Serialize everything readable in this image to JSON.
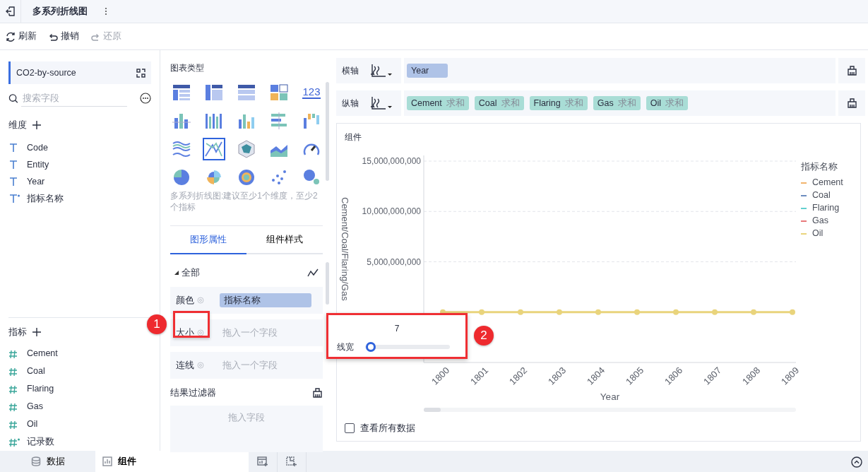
{
  "header": {
    "title": "多系列折线图"
  },
  "toolbar": [
    {
      "label": "刷新",
      "kind": "refresh",
      "disabled": false
    },
    {
      "label": "撤销",
      "kind": "undo",
      "disabled": false
    },
    {
      "label": "还原",
      "kind": "redo",
      "disabled": true
    }
  ],
  "dataset": {
    "name": "CO2-by-source",
    "search": {
      "placeholder": "搜索字段"
    }
  },
  "dimensions": {
    "title": "维度",
    "fields": [
      {
        "name": "Code",
        "kind": "text"
      },
      {
        "name": "Entity",
        "kind": "text"
      },
      {
        "name": "Year",
        "kind": "text"
      },
      {
        "name": "指标名称",
        "kind": "derived-text"
      }
    ]
  },
  "measures": {
    "title": "指标",
    "fields": [
      {
        "name": "Cement",
        "kind": "number"
      },
      {
        "name": "Coal",
        "kind": "number"
      },
      {
        "name": "Flaring",
        "kind": "number"
      },
      {
        "name": "Gas",
        "kind": "number"
      },
      {
        "name": "Oil",
        "kind": "number"
      },
      {
        "name": "记录数",
        "kind": "derived-number"
      }
    ]
  },
  "chart_types": {
    "title": "图表类型",
    "items": [
      {
        "kind": "table",
        "selected": false
      },
      {
        "kind": "crosstab",
        "selected": false
      },
      {
        "kind": "detail",
        "selected": false
      },
      {
        "kind": "blocks",
        "selected": false
      },
      {
        "kind": "kpi",
        "label": "123",
        "selected": false
      },
      {
        "kind": "stacked-bar",
        "selected": false
      },
      {
        "kind": "grouped-bar",
        "selected": false
      },
      {
        "kind": "bar",
        "selected": false
      },
      {
        "kind": "hbar",
        "selected": false
      },
      {
        "kind": "waterfall",
        "selected": false
      },
      {
        "kind": "stream",
        "selected": false
      },
      {
        "kind": "line",
        "selected": true
      },
      {
        "kind": "radar",
        "selected": false
      },
      {
        "kind": "area",
        "selected": false
      },
      {
        "kind": "gauge",
        "selected": false
      },
      {
        "kind": "pie",
        "selected": false
      },
      {
        "kind": "rose",
        "selected": false
      },
      {
        "kind": "sunburst",
        "selected": false
      },
      {
        "kind": "scatter",
        "selected": false
      },
      {
        "kind": "bubble",
        "selected": false
      }
    ],
    "hint": "多系列折线图:建议至少1个维度，至少2个指标"
  },
  "property_tabs": [
    {
      "label": "图形属性",
      "selected": true
    },
    {
      "label": "组件样式",
      "selected": false
    }
  ],
  "marks": {
    "group": "全部",
    "slots": [
      {
        "label": "颜色",
        "field": "指标名称"
      },
      {
        "label": "大小",
        "placeholder": "拖入一个字段"
      },
      {
        "label": "连线",
        "placeholder": "拖入一个字段"
      }
    ]
  },
  "result_filter": {
    "title": "结果过滤器",
    "placeholder": "拖入字段"
  },
  "axes": [
    {
      "label": "横轴",
      "fields": [
        {
          "name": "Year",
          "kind": "dimension"
        }
      ]
    },
    {
      "label": "纵轴",
      "fields": [
        {
          "name": "Cement",
          "aggregate": "求和",
          "kind": "measure"
        },
        {
          "name": "Coal",
          "aggregate": "求和",
          "kind": "measure"
        },
        {
          "name": "Flaring",
          "aggregate": "求和",
          "kind": "measure"
        },
        {
          "name": "Gas",
          "aggregate": "求和",
          "kind": "measure"
        },
        {
          "name": "Oil",
          "aggregate": "求和",
          "kind": "measure"
        }
      ]
    }
  ],
  "chart": {
    "title": "组件",
    "legend_title": "指标名称",
    "chart_data": {
      "type": "line",
      "xlabel": "Year",
      "ylabel": "Cement/Coal/Flaring/Gas",
      "categories": [
        "1800",
        "1801",
        "1802",
        "1803",
        "1804",
        "1805",
        "1806",
        "1807",
        "1808",
        "1809"
      ],
      "series": [
        {
          "name": "Cement",
          "color": "#f2b46c",
          "values": [
            null,
            null,
            null,
            null,
            null,
            null,
            null,
            null,
            null,
            null
          ]
        },
        {
          "name": "Coal",
          "color": "#6d8dbf",
          "values": [
            null,
            null,
            null,
            null,
            null,
            null,
            null,
            null,
            null,
            null
          ]
        },
        {
          "name": "Flaring",
          "color": "#63d0cf",
          "values": [
            null,
            null,
            null,
            null,
            null,
            null,
            null,
            null,
            null,
            null
          ]
        },
        {
          "name": "Gas",
          "color": "#e8797b",
          "values": [
            null,
            null,
            null,
            null,
            null,
            null,
            null,
            null,
            null,
            null
          ]
        },
        {
          "name": "Oil",
          "color": "#e9d47c",
          "marker": "circle",
          "values": [
            0,
            0,
            0,
            0,
            0,
            0,
            0,
            0,
            0,
            0
          ]
        }
      ],
      "ylim": [
        -5000000000,
        15000000000
      ],
      "yticks": [
        {
          "value": 5000000000,
          "label": "5,000,000,000"
        },
        {
          "value": 10000000000,
          "label": "10,000,000,000"
        },
        {
          "value": 15000000000,
          "label": "15,000,000,000"
        }
      ]
    },
    "show_all_data": {
      "label": "查看所有数据",
      "checked": false
    }
  },
  "line_width_popup": {
    "value": "7",
    "label": "线宽",
    "level": 0.03
  },
  "callouts": [
    {
      "number": "1"
    },
    {
      "number": "2"
    }
  ],
  "bottom_tabs": [
    {
      "label": "数据",
      "kind": "data",
      "selected": false
    },
    {
      "label": "组件",
      "kind": "widget",
      "selected": true
    }
  ]
}
